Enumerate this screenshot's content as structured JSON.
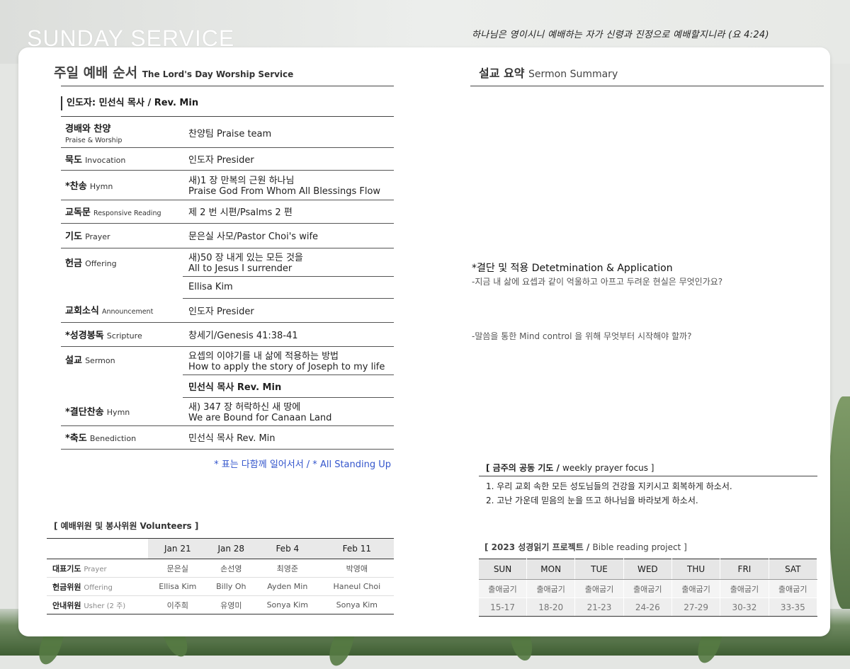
{
  "hero_title": "SUNDAY SERVICE",
  "verse": "하나님은 영이시니 예배하는 자가 신령과 진정으로 예배할지니라 (요 4:24)",
  "order": {
    "title_kr": "주일 예배 순서",
    "title_en": "The Lord's Day Worship Service",
    "leader": "인도자: 민선식 목사 / Rev. Min",
    "rows": [
      {
        "kr": "경배와 찬양",
        "en": "Praise & Worship",
        "val1": "찬양팀  Praise team",
        "val2": ""
      },
      {
        "kr": "묵도",
        "en": "Invocation",
        "val1": "인도자  Presider",
        "val2": ""
      },
      {
        "kr": "*찬송",
        "en": "Hymn",
        "val1": "새)1 장 만복의 근원 하나님",
        "val2": "Praise God From Whom All Blessings Flow"
      },
      {
        "kr": "교독문",
        "en": "Responsive Reading",
        "val1": "제 2 번 시편/Psalms 2 편",
        "val2": ""
      },
      {
        "kr": "기도",
        "en": "Prayer",
        "val1": "문은실 사모/Pastor Choi's wife",
        "val2": ""
      },
      {
        "kr": "헌금",
        "en": "Offering",
        "val1": "새)50 장 내게 있는 모든 것을",
        "val2": "All to Jesus I surrender",
        "val3": "Ellisa Kim"
      },
      {
        "kr": "교회소식",
        "en": "Announcement",
        "val1": "인도자  Presider",
        "val2": ""
      },
      {
        "kr": "*성경봉독",
        "en": "Scripture",
        "val1": "창세기/Genesis 41:38-41",
        "val2": ""
      },
      {
        "kr": "설교",
        "en": "Sermon",
        "val1": "요셉의 이야기를 내 삶에 적용하는 방법",
        "val2": "How to apply the story of Joseph to my life",
        "val3": "민선식 목사 Rev. Min"
      },
      {
        "kr": "*결단찬송",
        "en": "Hymn",
        "val1": "새) 347 장 허락하신 새 땅에",
        "val2": "We are Bound for Canaan Land"
      },
      {
        "kr": "*축도",
        "en": "Benediction",
        "val1": "민선식 목사  Rev. Min",
        "val2": ""
      }
    ],
    "standing_note": "* 표는 다함께 일어서서  /  * All Standing Up"
  },
  "volunteers": {
    "title": "[ 예배위원 및 봉사위원  Volunteers ]",
    "dates": [
      "Jan 21",
      "Jan 28",
      "Feb 4",
      "Feb 11"
    ],
    "rows": [
      {
        "role": "대표기도",
        "role_en": "Prayer",
        "names": [
          "문은실",
          "손선영",
          "최영준",
          "박영애"
        ]
      },
      {
        "role": "헌금위원",
        "role_en": "Offering",
        "names": [
          "Ellisa Kim",
          "Billy Oh",
          "Ayden Min",
          "Haneul Choi"
        ]
      },
      {
        "role": "안내위원",
        "role_en": "Usher (2 주)",
        "names": [
          "이주희",
          "유영미",
          "Sonya Kim",
          "Sonya Kim"
        ]
      }
    ]
  },
  "sermon": {
    "title_kr": "설교 요약",
    "title_en": "Sermon Summary",
    "apply_title": "*결단 및 적용 Detetmination & Application",
    "q1": "-지금 내 삶에 요셉과 같이 억울하고 아프고 두려운 현실은 무엇인가요?",
    "q2": "-말씀을 통한 Mind control 을 위해 무엇부터 시작해야 할까?"
  },
  "prayer": {
    "title_kr": "[ 금주의 공동 기도  /",
    "title_en": "weekly prayer focus ]",
    "items": [
      "1. 우리 교회 속한 모든 성도님들의 건강을 지키시고 회복하게 하소서.",
      "2. 고난 가운데 믿음의 눈을 뜨고 하나님을 바라보게 하소서."
    ]
  },
  "bible": {
    "title_kr": "[ 2023 성경읽기 프로젝트  /",
    "title_en": "Bible reading project ]",
    "days": [
      "SUN",
      "MON",
      "TUE",
      "WED",
      "THU",
      "FRI",
      "SAT"
    ],
    "books": [
      "출애굽기",
      "출애굽기",
      "출애굽기",
      "출애굽기",
      "출애굽기",
      "출애굽기",
      "출애굽기"
    ],
    "chapters": [
      "15-17",
      "18-20",
      "21-23",
      "24-26",
      "27-29",
      "30-32",
      "33-35"
    ]
  }
}
